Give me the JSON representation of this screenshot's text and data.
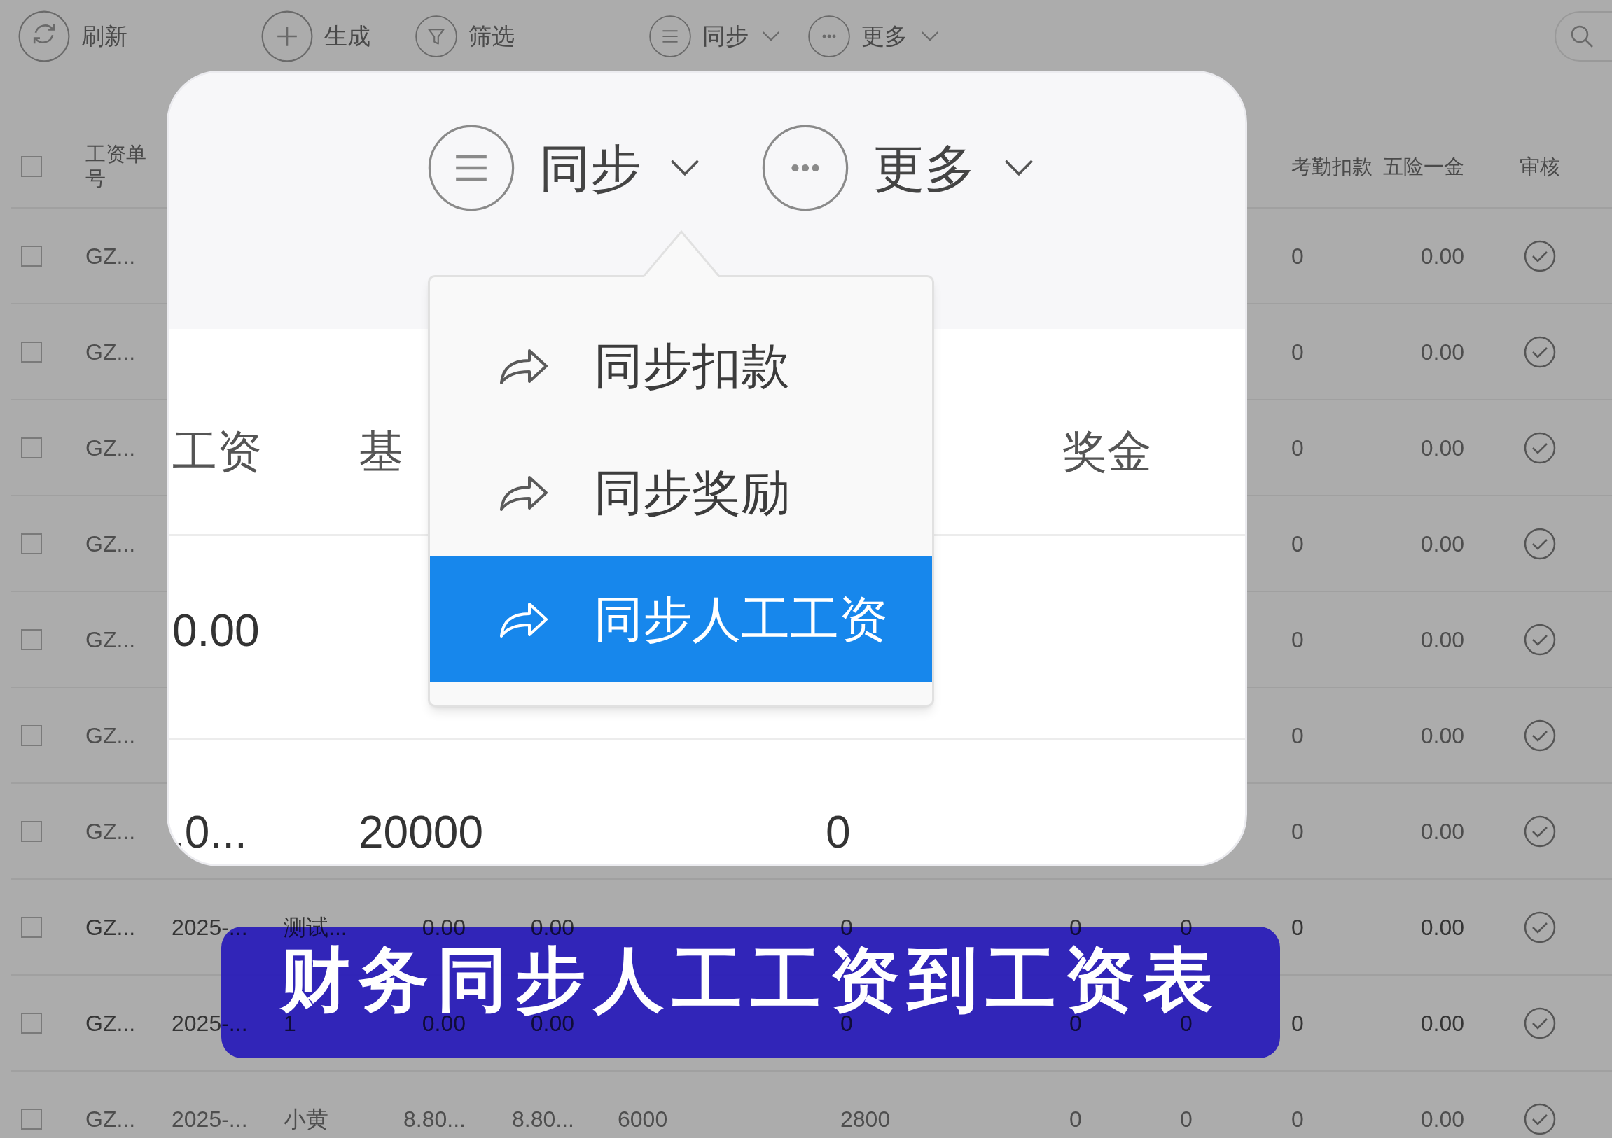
{
  "toolbar": {
    "buttons": [
      {
        "kind": "refresh",
        "label": "刷新",
        "dropdown": false
      },
      {
        "kind": "add",
        "label": "生成",
        "dropdown": false
      },
      {
        "kind": "filter",
        "label": "筛选",
        "dropdown": false
      },
      {
        "kind": "menu",
        "label": "同步",
        "dropdown": true
      },
      {
        "kind": "more",
        "label": "更多",
        "dropdown": true
      }
    ]
  },
  "table": {
    "header": {
      "checked": false,
      "order_no": "工资单号",
      "attendance_deduction": "考勤扣款",
      "insurance": "五险一金",
      "review": "审核"
    },
    "rows": [
      {
        "checked": false,
        "order_no": "GZ...",
        "attendance_deduction": "0",
        "insurance": "0.00"
      },
      {
        "checked": false,
        "order_no": "GZ...",
        "attendance_deduction": "0",
        "insurance": "0.00"
      },
      {
        "checked": false,
        "order_no": "GZ...",
        "attendance_deduction": "0",
        "insurance": "0.00"
      },
      {
        "checked": false,
        "order_no": "GZ...",
        "attendance_deduction": "0",
        "insurance": "0.00"
      },
      {
        "checked": false,
        "order_no": "GZ...",
        "attendance_deduction": "0",
        "insurance": "0.00"
      },
      {
        "checked": false,
        "order_no": "GZ...",
        "attendance_deduction": "0",
        "insurance": "0.00"
      },
      {
        "checked": false,
        "order_no": "GZ...",
        "attendance_deduction": "0",
        "insurance": "0.00"
      },
      {
        "checked": false,
        "order_no": "GZ...",
        "column_3": "2025-...",
        "column_4": "测试...",
        "column_5": "0.00",
        "column_6": "0.00",
        "column_8": "0",
        "column_9": "0",
        "column_10": "0",
        "attendance_deduction": "0",
        "insurance": "0.00"
      },
      {
        "checked": false,
        "order_no": "GZ...",
        "column_3": "2025-...",
        "column_4": "1",
        "column_5": "0.00",
        "column_6": "0.00",
        "column_8": "0",
        "column_9": "0",
        "column_10": "0",
        "attendance_deduction": "0",
        "insurance": "0.00"
      },
      {
        "checked": false,
        "order_no": "GZ...",
        "column_3": "2025-...",
        "column_4": "小黄",
        "column_5": "8.80...",
        "column_6": "8.80...",
        "column_7": "6000",
        "column_8": "2800",
        "column_9": "0",
        "column_10": "0",
        "attendance_deduction": "0",
        "insurance": "0.00"
      }
    ]
  },
  "callout": {
    "toolbar": [
      {
        "kind": "menu",
        "label": "同步"
      },
      {
        "kind": "more",
        "label": "更多"
      }
    ],
    "menu": {
      "items": [
        {
          "label": "同步扣款",
          "selected": false
        },
        {
          "label": "同步奖励",
          "selected": false
        },
        {
          "label": "同步人工工资",
          "selected": true
        }
      ]
    },
    "table": {
      "header": {
        "column_1": "工资",
        "column_2": "基",
        "column_4": "奖金"
      },
      "rows": [
        {
          "column_1": "0.00"
        },
        {
          "column_1": ".0...",
          "column_2": "20000",
          "column_3": "0"
        }
      ]
    }
  },
  "banner": {
    "caption": "财务同步人工工资到工资表"
  }
}
